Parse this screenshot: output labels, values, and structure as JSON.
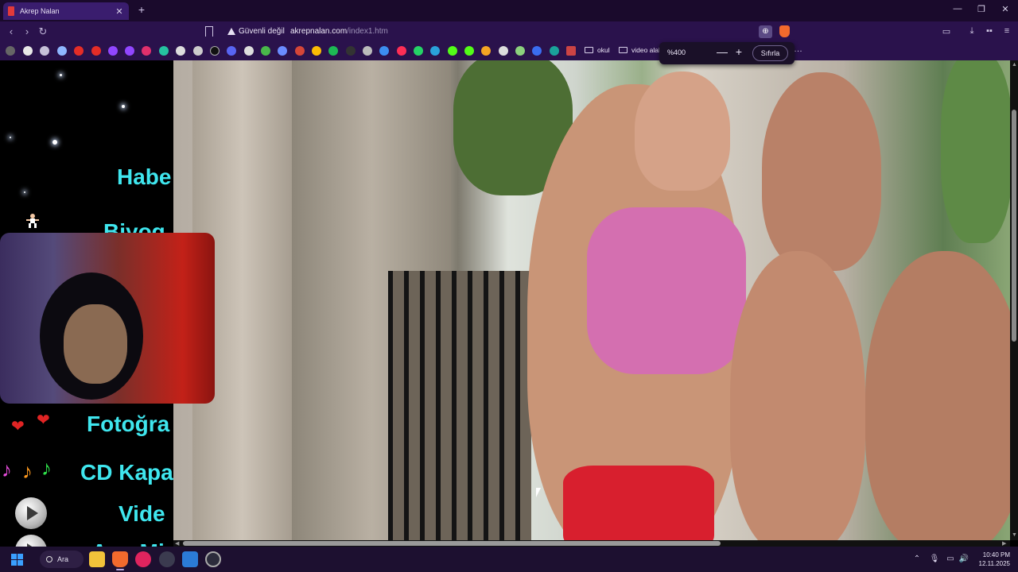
{
  "tab": {
    "title": "Akrep Nalan",
    "close": "✕",
    "new": "+"
  },
  "window_controls": {
    "minimize": "—",
    "maximize": "❐",
    "close": "✕"
  },
  "nav": {
    "back": "‹",
    "forward": "›",
    "reload": "↻"
  },
  "address": {
    "security_label": "Güvenli değil",
    "domain": "akrepnalan.com",
    "path": "/index1.htm"
  },
  "toolbar": {
    "zoom_glyph": "⊕",
    "sidebar": "▭",
    "download": "⤓",
    "wallet": "▪▪",
    "menu": "≡"
  },
  "bookmarks": {
    "folders": [
      {
        "label": "okul"
      },
      {
        "label": "video alak"
      }
    ],
    "more": "…"
  },
  "zoom": {
    "value": "%400",
    "minus": "—",
    "plus": "+",
    "reset": "Sıfırla"
  },
  "page": {
    "links": [
      "Habe",
      "Biyog",
      "Fotoğra",
      "CD Kapa",
      "Vide",
      "Ana Mi"
    ],
    "hearts": [
      "❤",
      "❤"
    ],
    "notes": [
      "♪",
      "♪",
      "♪"
    ]
  },
  "taskbar": {
    "search_label": "Ara",
    "clock_time": "10:40 PM",
    "clock_date": "12.11.2025",
    "tray": {
      "chevron": "⌃",
      "mic": "🎙",
      "display": "▭",
      "volume": "🔊"
    }
  },
  "colors": {
    "link": "#3fe6ee",
    "accent": "#3a1d6e",
    "brave": "#f26a2d"
  }
}
